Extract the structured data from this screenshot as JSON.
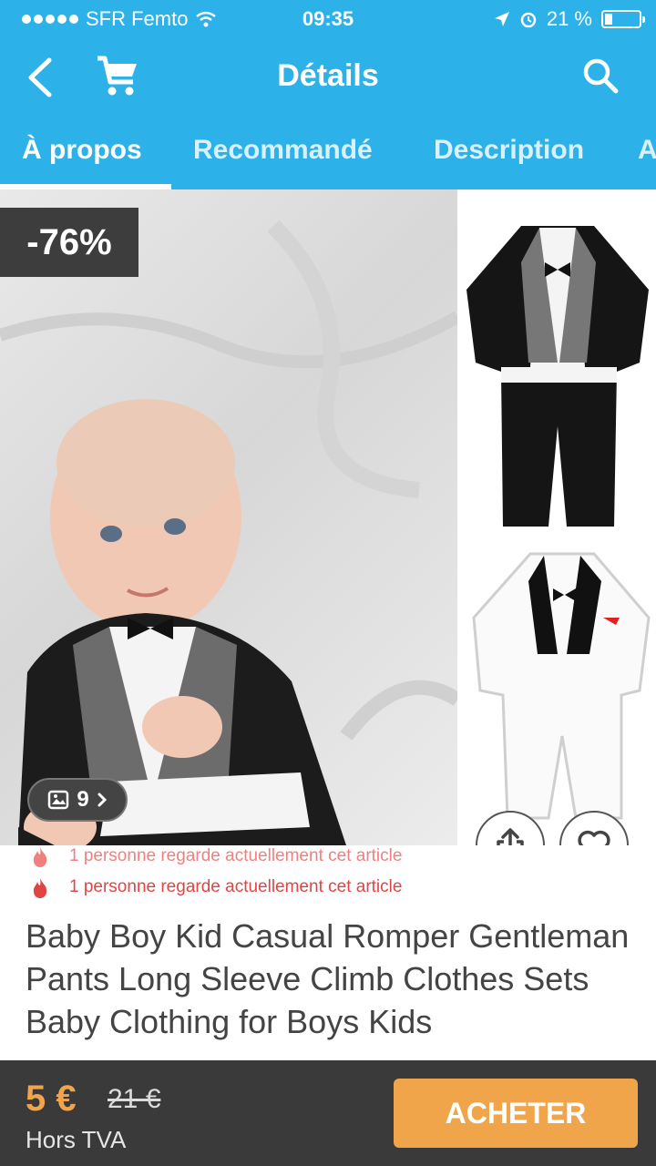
{
  "status_bar": {
    "carrier": "SFR Femto",
    "time": "09:35",
    "battery": "21 %",
    "battery_level": 0.21
  },
  "header": {
    "title": "Détails",
    "icons": [
      "back-icon",
      "cart-icon",
      "search-icon"
    ]
  },
  "tabs": [
    {
      "label": "À propos",
      "active": true
    },
    {
      "label": "Recommandé",
      "active": false
    },
    {
      "label": "Description",
      "active": false
    },
    {
      "label": "A",
      "active": false
    }
  ],
  "gallery": {
    "discount": "-76%",
    "photo_count": "9",
    "icons": [
      "image-icon",
      "chevron-right-icon",
      "share-icon",
      "heart-icon"
    ]
  },
  "viewers": {
    "text": "1 personne regarde actuellement cet article"
  },
  "product": {
    "title": "Baby Boy Kid Casual Romper Gentleman Pants Long Sleeve Climb Clothes Sets Baby Clothing for Boys Kids"
  },
  "purchase": {
    "price": "5 €",
    "old_price": "21 €",
    "tax_note": "Hors TVA",
    "buy_label": "ACHETER"
  },
  "colors": {
    "primary": "#2cb1e8",
    "accent": "#f0a54b",
    "bottom_bar": "#3a3a3a",
    "viewers_text": "#f08080"
  }
}
